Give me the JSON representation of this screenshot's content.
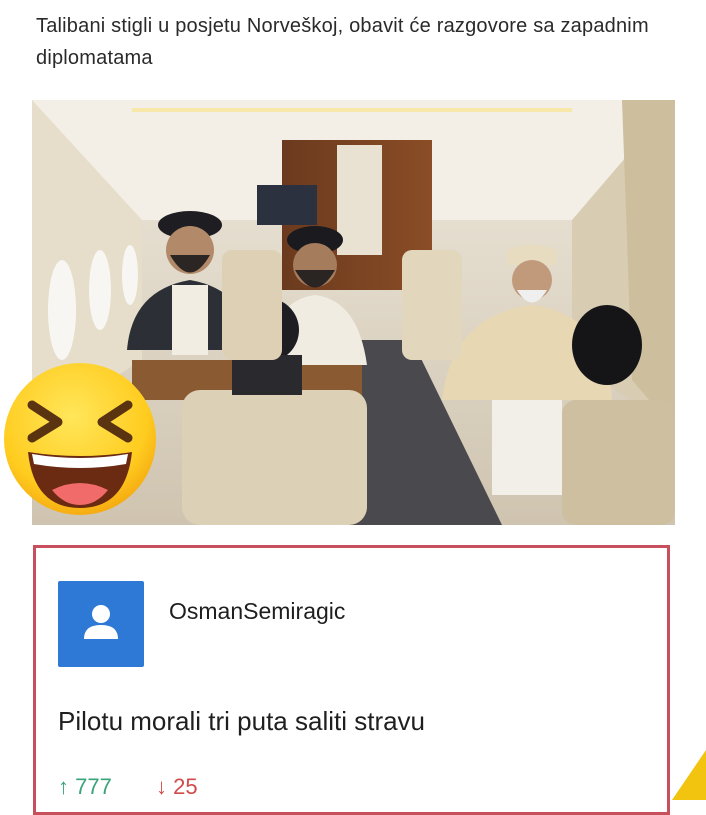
{
  "post": {
    "headline": "Talibani stigli u posjetu Norveškoj, obavit će razgovore sa zapadnim  diplomatama"
  },
  "comment": {
    "username": "OsmanSemiragic",
    "text": "Pilotu morali tri puta saliti stravu",
    "upvotes": "777",
    "downvotes": "25",
    "upvote_icon": "↑",
    "downvote_icon": "↓"
  },
  "colors": {
    "avatar_bg": "#2f79d6",
    "card_border": "#c8505c",
    "upvote": "#39a37a",
    "downvote": "#d24b4b"
  },
  "icons": {
    "emoji": "laughing-face-icon",
    "avatar": "user-icon",
    "corner": "corner-triangle-icon"
  }
}
